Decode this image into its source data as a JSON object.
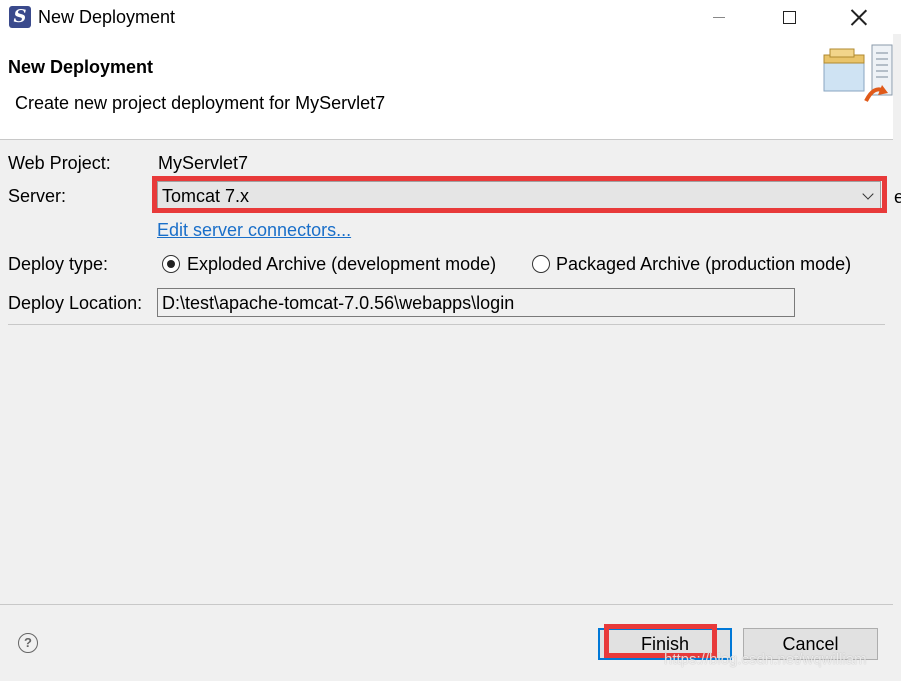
{
  "window": {
    "title": "New Deployment"
  },
  "banner": {
    "title": "New Deployment",
    "description": "Create new project deployment for MyServlet7"
  },
  "form": {
    "web_project_label": "Web Project:",
    "web_project_value": "MyServlet7",
    "server_label": "Server:",
    "server_value": "Tomcat  7.x",
    "edit_connectors_link": "Edit server connectors...",
    "deploy_type_label": "Deploy type:",
    "deploy_type_options": [
      {
        "label": "Exploded Archive (development mode)",
        "selected": true
      },
      {
        "label": "Packaged Archive (production mode)",
        "selected": false
      }
    ],
    "deploy_location_label": "Deploy Location:",
    "deploy_location_value": "D:\\test\\apache-tomcat-7.0.56\\webapps\\login",
    "cut_char_server_row": "e",
    "cut_char_top": "-"
  },
  "buttons": {
    "help_symbol": "?",
    "finish_label": "Finish",
    "cancel_label": "Cancel"
  },
  "watermark": "https://blog.csdn.net/wqwilliam",
  "colors": {
    "highlight": "#e83a3a",
    "link": "#1a6fc9",
    "focus_border": "#0078d7"
  },
  "icons": [
    "app-logo-icon",
    "minimize-icon",
    "maximize-icon",
    "close-icon",
    "server-deploy-icon",
    "help-icon",
    "chevron-down-icon"
  ]
}
